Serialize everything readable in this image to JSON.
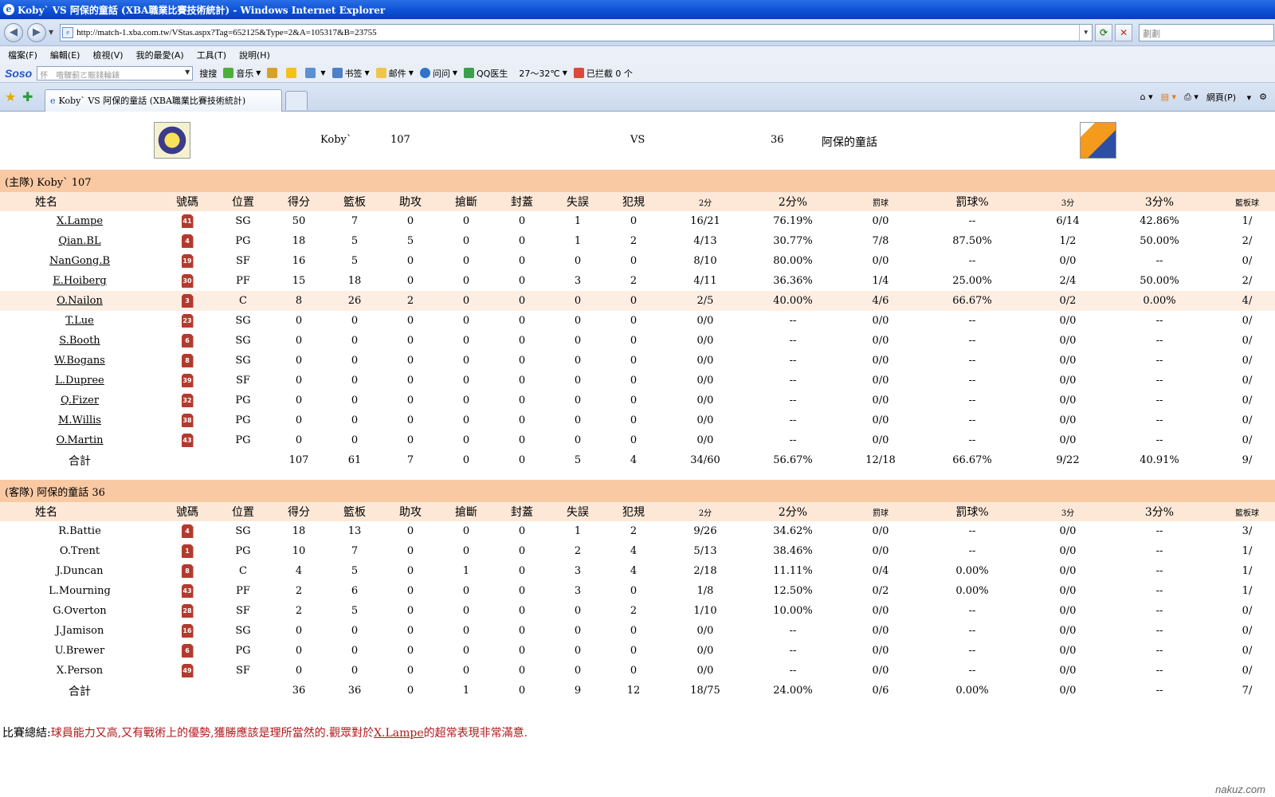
{
  "window": {
    "title": "Koby` VS 阿保的童話 (XBA職業比賽技術統計) - Windows Internet Explorer"
  },
  "address_bar": {
    "url": "http://match-1.xba.com.tw/VStas.aspx?Tag=652125&Type=2&A=105317&B=23755",
    "search_placeholder": "劃劃"
  },
  "menu": [
    "檔案(F)",
    "編輯(E)",
    "檢視(V)",
    "我的最愛(A)",
    "工具(T)",
    "說明(H)"
  ],
  "toolbar": {
    "brand": "Soso",
    "search_placeholder": "怀　喒驟蓟ㄛ賑錢輪錶",
    "search_button": "搜搜",
    "music": "音乐",
    "bookmark": "书签",
    "mail": "邮件",
    "ask": "问问",
    "qq_doctor": "QQ医生",
    "weather": "27～32℃",
    "blocked": "已拦截 0 个"
  },
  "tabs": {
    "active_title": "Koby` VS 阿保的童話 (XBA職業比賽技術統計)",
    "page_menu": "網頁(P)"
  },
  "match": {
    "home_name": "Koby`",
    "home_score": "107",
    "vs": "VS",
    "away_score": "36",
    "away_name": "阿保的童話"
  },
  "columns": [
    "姓名",
    "號碼",
    "位置",
    "得分",
    "籃板",
    "助攻",
    "搶斷",
    "封蓋",
    "失誤",
    "犯規",
    "2分",
    "2分%",
    "罰球",
    "罰球%",
    "3分",
    "3分%",
    "籃板球"
  ],
  "home_team": {
    "label": "(主隊) Koby`  107",
    "players": [
      {
        "name": "X.Lampe",
        "num": "41",
        "pos": "SG",
        "stats": [
          "50",
          "7",
          "0",
          "0",
          "0",
          "1",
          "0",
          "16/21",
          "76.19%",
          "0/0",
          "--",
          "6/14",
          "42.86%",
          "1/"
        ]
      },
      {
        "name": "Qian.BL",
        "num": "4",
        "pos": "PG",
        "stats": [
          "18",
          "5",
          "5",
          "0",
          "0",
          "1",
          "2",
          "4/13",
          "30.77%",
          "7/8",
          "87.50%",
          "1/2",
          "50.00%",
          "2/"
        ]
      },
      {
        "name": "NanGong.B",
        "num": "19",
        "pos": "SF",
        "stats": [
          "16",
          "5",
          "0",
          "0",
          "0",
          "0",
          "0",
          "8/10",
          "80.00%",
          "0/0",
          "--",
          "0/0",
          "--",
          "0/"
        ]
      },
      {
        "name": "E.Hoiberg",
        "num": "30",
        "pos": "PF",
        "stats": [
          "15",
          "18",
          "0",
          "0",
          "0",
          "3",
          "2",
          "4/11",
          "36.36%",
          "1/4",
          "25.00%",
          "2/4",
          "50.00%",
          "2/"
        ]
      },
      {
        "name": "O.Nailon",
        "num": "3",
        "pos": "C",
        "stats": [
          "8",
          "26",
          "2",
          "0",
          "0",
          "0",
          "0",
          "2/5",
          "40.00%",
          "4/6",
          "66.67%",
          "0/2",
          "0.00%",
          "4/"
        ]
      },
      {
        "name": "T.Lue",
        "num": "23",
        "pos": "SG",
        "stats": [
          "0",
          "0",
          "0",
          "0",
          "0",
          "0",
          "0",
          "0/0",
          "--",
          "0/0",
          "--",
          "0/0",
          "--",
          "0/"
        ]
      },
      {
        "name": "S.Booth",
        "num": "6",
        "pos": "SG",
        "stats": [
          "0",
          "0",
          "0",
          "0",
          "0",
          "0",
          "0",
          "0/0",
          "--",
          "0/0",
          "--",
          "0/0",
          "--",
          "0/"
        ]
      },
      {
        "name": "W.Bogans",
        "num": "8",
        "pos": "SG",
        "stats": [
          "0",
          "0",
          "0",
          "0",
          "0",
          "0",
          "0",
          "0/0",
          "--",
          "0/0",
          "--",
          "0/0",
          "--",
          "0/"
        ]
      },
      {
        "name": "L.Dupree",
        "num": "39",
        "pos": "SF",
        "stats": [
          "0",
          "0",
          "0",
          "0",
          "0",
          "0",
          "0",
          "0/0",
          "--",
          "0/0",
          "--",
          "0/0",
          "--",
          "0/"
        ]
      },
      {
        "name": "Q.Fizer",
        "num": "32",
        "pos": "PG",
        "stats": [
          "0",
          "0",
          "0",
          "0",
          "0",
          "0",
          "0",
          "0/0",
          "--",
          "0/0",
          "--",
          "0/0",
          "--",
          "0/"
        ]
      },
      {
        "name": "M.Willis",
        "num": "38",
        "pos": "PG",
        "stats": [
          "0",
          "0",
          "0",
          "0",
          "0",
          "0",
          "0",
          "0/0",
          "--",
          "0/0",
          "--",
          "0/0",
          "--",
          "0/"
        ]
      },
      {
        "name": "O.Martin",
        "num": "43",
        "pos": "PG",
        "stats": [
          "0",
          "0",
          "0",
          "0",
          "0",
          "0",
          "0",
          "0/0",
          "--",
          "0/0",
          "--",
          "0/0",
          "--",
          "0/"
        ]
      }
    ],
    "total_label": "合計",
    "totals": [
      "107",
      "61",
      "7",
      "0",
      "0",
      "5",
      "4",
      "34/60",
      "56.67%",
      "12/18",
      "66.67%",
      "9/22",
      "40.91%",
      "9/"
    ]
  },
  "away_team": {
    "label": "(客隊) 阿保的童話  36",
    "players": [
      {
        "name": "R.Battie",
        "num": "4",
        "pos": "SG",
        "stats": [
          "18",
          "13",
          "0",
          "0",
          "0",
          "1",
          "2",
          "9/26",
          "34.62%",
          "0/0",
          "--",
          "0/0",
          "--",
          "3/"
        ]
      },
      {
        "name": "O.Trent",
        "num": "1",
        "pos": "PG",
        "stats": [
          "10",
          "7",
          "0",
          "0",
          "0",
          "2",
          "4",
          "5/13",
          "38.46%",
          "0/0",
          "--",
          "0/0",
          "--",
          "1/"
        ]
      },
      {
        "name": "J.Duncan",
        "num": "8",
        "pos": "C",
        "stats": [
          "4",
          "5",
          "0",
          "1",
          "0",
          "3",
          "4",
          "2/18",
          "11.11%",
          "0/4",
          "0.00%",
          "0/0",
          "--",
          "1/"
        ]
      },
      {
        "name": "L.Mourning",
        "num": "43",
        "pos": "PF",
        "stats": [
          "2",
          "6",
          "0",
          "0",
          "0",
          "3",
          "0",
          "1/8",
          "12.50%",
          "0/2",
          "0.00%",
          "0/0",
          "--",
          "1/"
        ]
      },
      {
        "name": "G.Overton",
        "num": "28",
        "pos": "SF",
        "stats": [
          "2",
          "5",
          "0",
          "0",
          "0",
          "0",
          "2",
          "1/10",
          "10.00%",
          "0/0",
          "--",
          "0/0",
          "--",
          "0/"
        ]
      },
      {
        "name": "J.Jamison",
        "num": "16",
        "pos": "SG",
        "stats": [
          "0",
          "0",
          "0",
          "0",
          "0",
          "0",
          "0",
          "0/0",
          "--",
          "0/0",
          "--",
          "0/0",
          "--",
          "0/"
        ]
      },
      {
        "name": "U.Brewer",
        "num": "6",
        "pos": "PG",
        "stats": [
          "0",
          "0",
          "0",
          "0",
          "0",
          "0",
          "0",
          "0/0",
          "--",
          "0/0",
          "--",
          "0/0",
          "--",
          "0/"
        ]
      },
      {
        "name": "X.Person",
        "num": "49",
        "pos": "SF",
        "stats": [
          "0",
          "0",
          "0",
          "0",
          "0",
          "0",
          "0",
          "0/0",
          "--",
          "0/0",
          "--",
          "0/0",
          "--",
          "0/"
        ]
      }
    ],
    "total_label": "合計",
    "totals": [
      "36",
      "36",
      "0",
      "1",
      "0",
      "9",
      "12",
      "18/75",
      "24.00%",
      "0/6",
      "0.00%",
      "0/0",
      "--",
      "7/"
    ]
  },
  "summary": {
    "label": "比賽總結:",
    "text_before": "球員能力又高,又有戰術上的優勢,獲勝應該是理所當然的.觀眾對於",
    "player_link": "X.Lampe",
    "text_after": "的超常表現非常滿意."
  },
  "watermark": "nakuz.com"
}
